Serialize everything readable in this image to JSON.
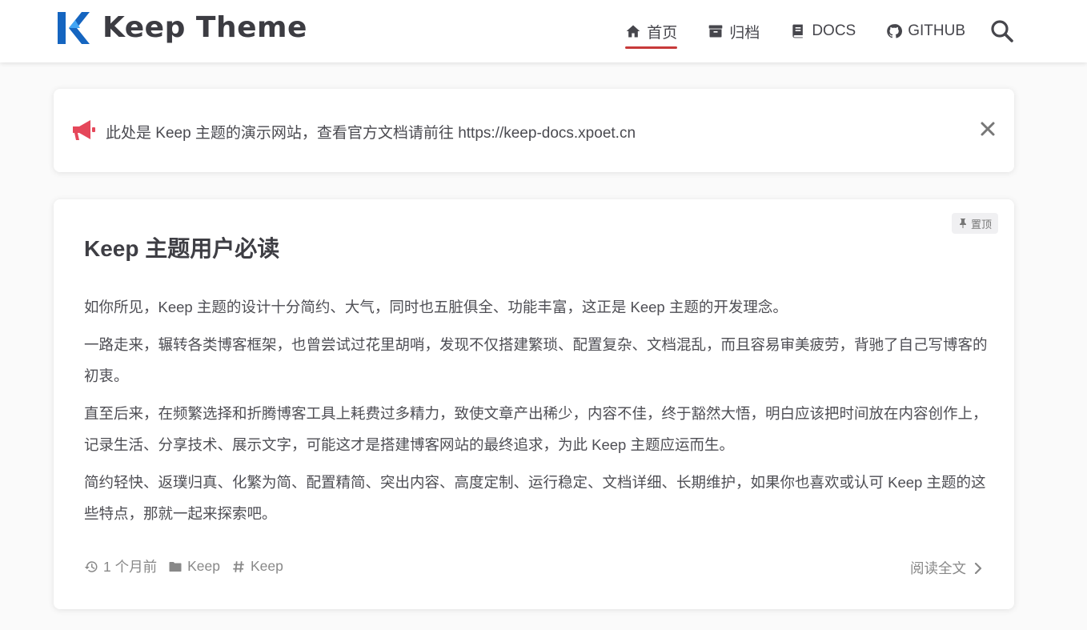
{
  "header": {
    "site_title": "Keep Theme",
    "nav": [
      {
        "label": "首页",
        "icon": "home-icon",
        "active": true
      },
      {
        "label": "归档",
        "icon": "archive-icon",
        "active": false
      },
      {
        "label": "DOCS",
        "icon": "book-icon",
        "active": false
      },
      {
        "label": "GITHUB",
        "icon": "github-icon",
        "active": false
      }
    ],
    "search_icon": "search-icon"
  },
  "notice": {
    "icon": "megaphone-icon",
    "text": "此处是 Keep 主题的演示网站，查看官方文档请前往 https://keep-docs.xpoet.cn",
    "close_icon": "close-icon"
  },
  "post": {
    "pin_label": "置顶",
    "title": "Keep 主题用户必读",
    "paragraphs": [
      "如你所见，Keep 主题的设计十分简约、大气，同时也五脏俱全、功能丰富，这正是 Keep 主题的开发理念。",
      "一路走来，辗转各类博客框架，也曾尝试过花里胡哨，发现不仅搭建繁琐、配置复杂、文档混乱，而且容易审美疲劳，背驰了自己写博客的初衷。",
      "直至后来，在频繁选择和折腾博客工具上耗费过多精力，致使文章产出稀少，内容不佳，终于豁然大悟，明白应该把时间放在内容创作上，记录生活、分享技术、展示文字，可能这才是搭建博客网站的最终追求，为此 Keep 主题应运而生。",
      "简约轻快、返璞归真、化繁为简、配置精简、突出内容、高度定制、运行稳定、文档详细、长期维护，如果你也喜欢或认可 Keep 主题的这些特点，那就一起来探索吧。"
    ],
    "meta": {
      "time": "1 个月前",
      "category": "Keep",
      "tag": "Keep"
    },
    "read_more": "阅读全文"
  },
  "colors": {
    "brand_blue": "#1565c0",
    "accent_red": "#c73a3a",
    "notice_icon": "#e5475a",
    "text": "#4a4a50"
  }
}
